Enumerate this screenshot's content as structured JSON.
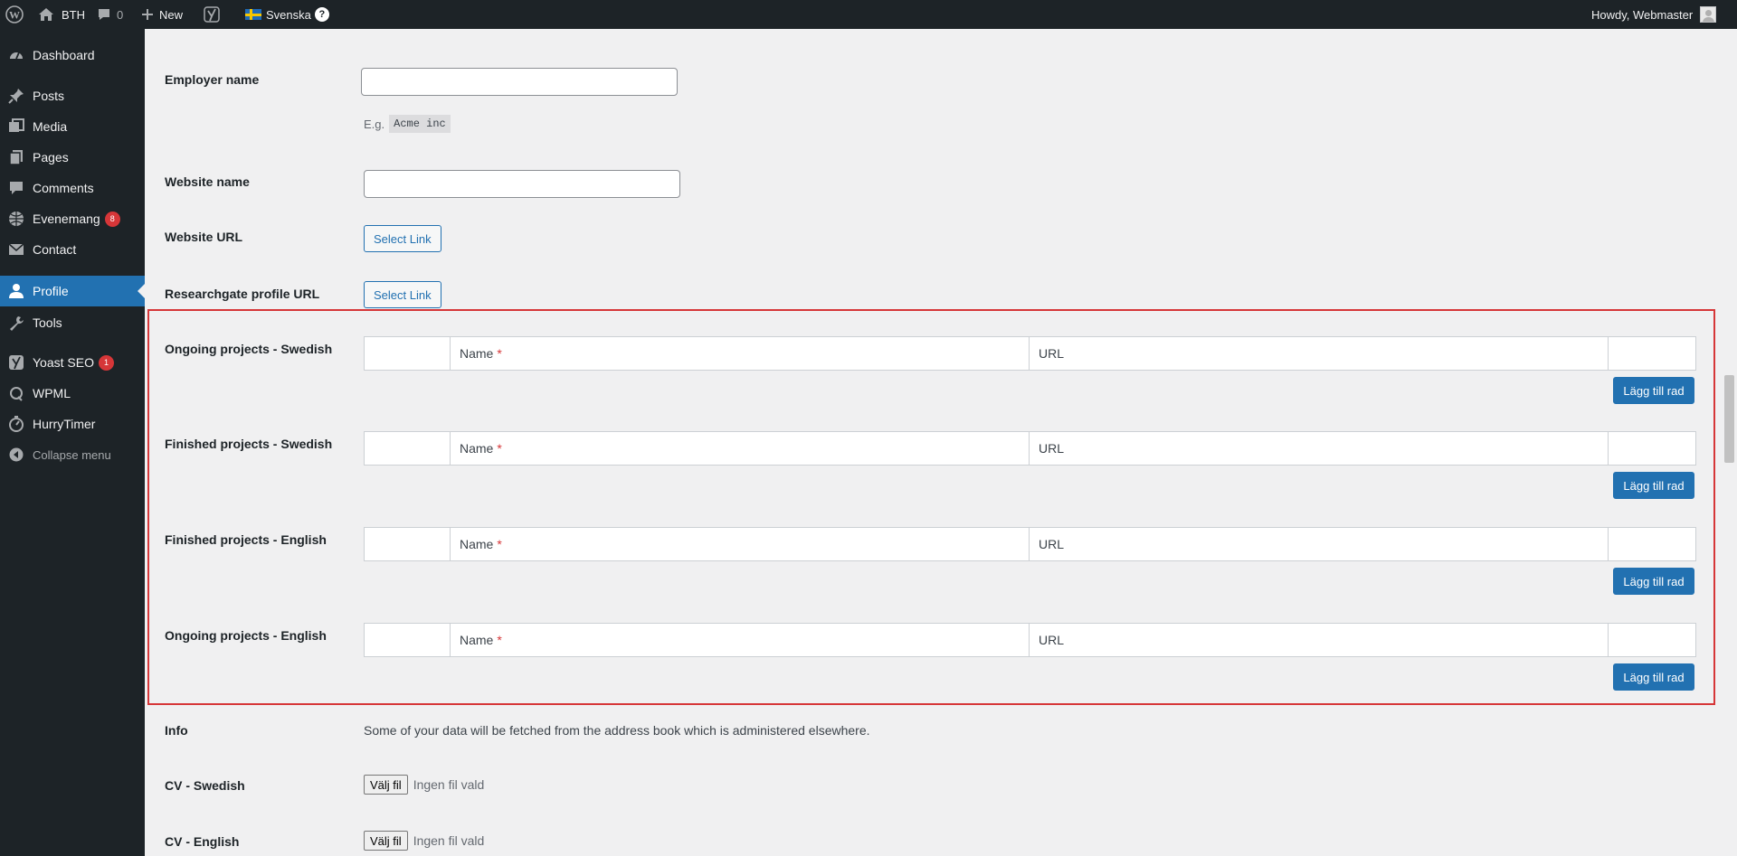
{
  "adminbar": {
    "site_name": "BTH",
    "comments_count": "0",
    "new_label": "New",
    "language_label": "Svenska",
    "language_help": "?",
    "greeting": "Howdy, Webmaster"
  },
  "sidebar": {
    "items": [
      {
        "label": "Dashboard",
        "icon": "dashboard-icon"
      },
      {
        "label": "Posts",
        "icon": "pin-icon"
      },
      {
        "label": "Media",
        "icon": "media-icon"
      },
      {
        "label": "Pages",
        "icon": "pages-icon"
      },
      {
        "label": "Comments",
        "icon": "comment-icon"
      },
      {
        "label": "Evenemang",
        "icon": "calendar-icon",
        "badge": "8"
      },
      {
        "label": "Contact",
        "icon": "mail-icon"
      },
      {
        "label": "Profile",
        "icon": "user-icon",
        "current": true
      },
      {
        "label": "Tools",
        "icon": "wrench-icon"
      },
      {
        "label": "Yoast SEO",
        "icon": "yoast-icon",
        "badge": "1"
      },
      {
        "label": "WPML",
        "icon": "wpml-icon"
      },
      {
        "label": "HurryTimer",
        "icon": "timer-icon"
      },
      {
        "label": "Collapse menu",
        "icon": "collapse-icon"
      }
    ]
  },
  "form": {
    "employer_name": {
      "label": "Employer name",
      "value": "",
      "hint_prefix": "E.g.",
      "hint_code": "Acme inc"
    },
    "website_name": {
      "label": "Website name",
      "value": ""
    },
    "website_url": {
      "label": "Website URL",
      "button": "Select Link"
    },
    "researchgate_url": {
      "label": "Researchgate profile URL",
      "button": "Select Link"
    },
    "repeaters": [
      {
        "label": "Ongoing projects - Swedish",
        "col_name": "Name",
        "col_url": "URL",
        "required_mark": "*",
        "add_button": "Lägg till rad"
      },
      {
        "label": "Finished projects - Swedish",
        "col_name": "Name",
        "col_url": "URL",
        "required_mark": "*",
        "add_button": "Lägg till rad"
      },
      {
        "label": "Finished projects - English",
        "col_name": "Name",
        "col_url": "URL",
        "required_mark": "*",
        "add_button": "Lägg till rad"
      },
      {
        "label": "Ongoing projects - English",
        "col_name": "Name",
        "col_url": "URL",
        "required_mark": "*",
        "add_button": "Lägg till rad"
      }
    ],
    "info": {
      "label": "Info",
      "text": "Some of your data will be fetched from the address book which is administered elsewhere."
    },
    "cv_swedish": {
      "label": "CV - Swedish",
      "button": "Välj fil",
      "status": "Ingen fil vald"
    },
    "cv_english": {
      "label": "CV - English",
      "button": "Välj fil",
      "status": "Ingen fil vald"
    }
  },
  "colors": {
    "accent": "#2271b1",
    "admin_bg": "#1d2327",
    "highlight": "#d63638"
  }
}
